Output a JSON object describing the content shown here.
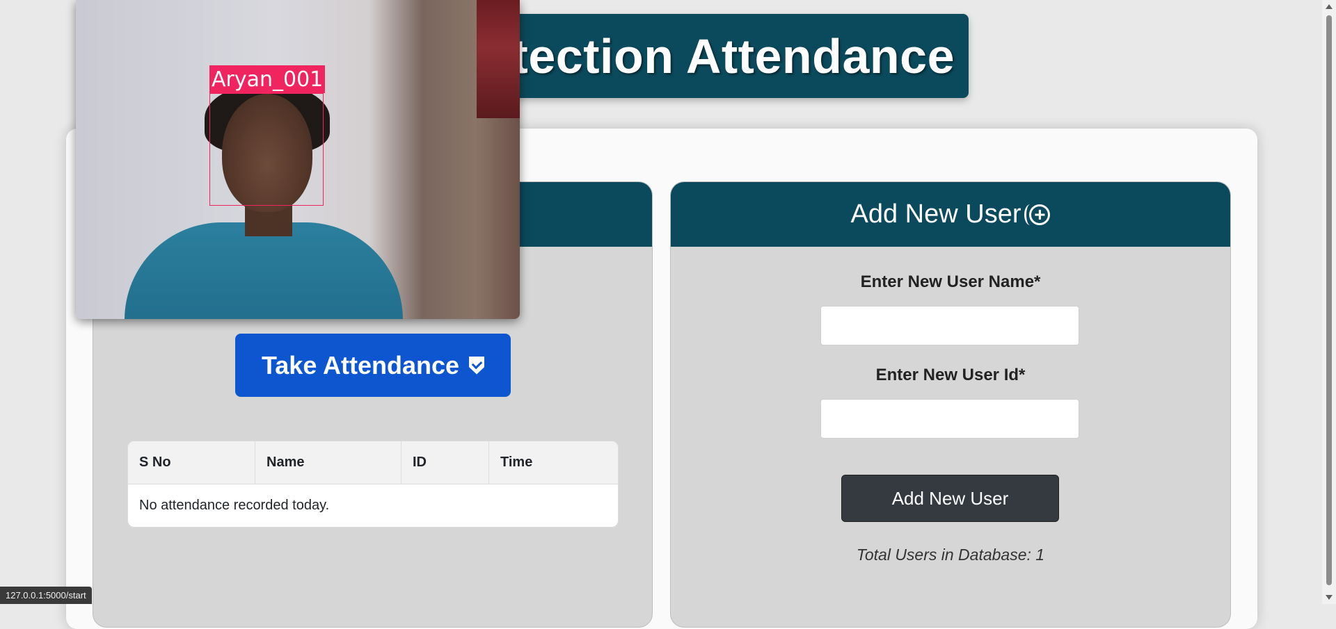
{
  "header": {
    "title": "etection Attendance"
  },
  "camera": {
    "face_label": "Aryan_001"
  },
  "attendance": {
    "take_button_label": "Take Attendance",
    "columns": [
      "S No",
      "Name",
      "ID",
      "Time"
    ],
    "empty_message": "No attendance recorded today."
  },
  "add_user": {
    "header": "Add New User",
    "name_label": "Enter New User Name*",
    "id_label": "Enter New User Id*",
    "name_value": "",
    "id_value": "",
    "button_label": "Add New User",
    "total_text": "Total Users in Database: 1"
  },
  "status_bar": {
    "url": "127.0.0.1:5000/start"
  },
  "colors": {
    "header_bg": "#0b4a5c",
    "take_button_bg": "#0d56cf",
    "add_button_bg": "#343a40",
    "face_box": "#f0245e"
  },
  "icons": {
    "add_user": "plus-circle-icon",
    "take_attendance": "shield-check-icon"
  }
}
